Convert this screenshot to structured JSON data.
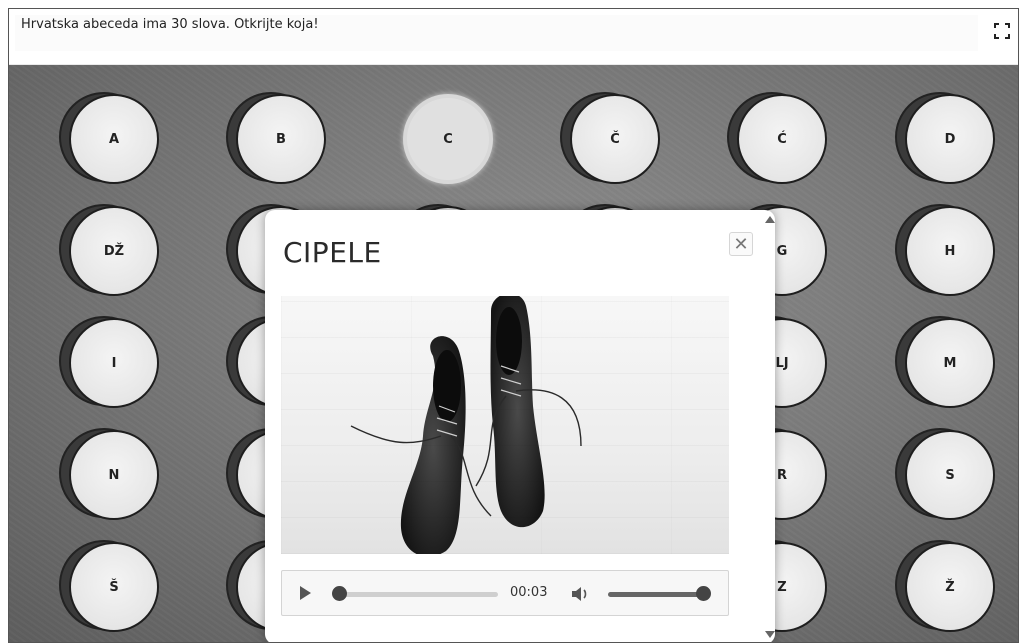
{
  "header": {
    "title": "Hrvatska abeceda ima 30 slova. Otkrijte koja!",
    "fullscreen_icon": "fullscreen-icon"
  },
  "letters": [
    {
      "label": "A"
    },
    {
      "label": "B"
    },
    {
      "label": "C"
    },
    {
      "label": "Č"
    },
    {
      "label": "Ć"
    },
    {
      "label": "D"
    },
    {
      "label": "DŽ"
    },
    {
      "label": ""
    },
    {
      "label": ""
    },
    {
      "label": ""
    },
    {
      "label": "G"
    },
    {
      "label": "H"
    },
    {
      "label": "I"
    },
    {
      "label": ""
    },
    {
      "label": ""
    },
    {
      "label": ""
    },
    {
      "label": "LJ"
    },
    {
      "label": "M"
    },
    {
      "label": "N"
    },
    {
      "label": ""
    },
    {
      "label": ""
    },
    {
      "label": ""
    },
    {
      "label": "R"
    },
    {
      "label": "S"
    },
    {
      "label": "Š"
    },
    {
      "label": ""
    },
    {
      "label": ""
    },
    {
      "label": ""
    },
    {
      "label": "Z"
    },
    {
      "label": "Ž"
    }
  ],
  "selected_letter": "C",
  "modal": {
    "title": "CIPELE",
    "close_icon": "close-icon",
    "image_subject": "shoes",
    "audio": {
      "time": "00:03",
      "progress": 0.0,
      "volume": 1.0,
      "play_icon": "play-icon",
      "volume_icon": "volume-icon"
    }
  }
}
